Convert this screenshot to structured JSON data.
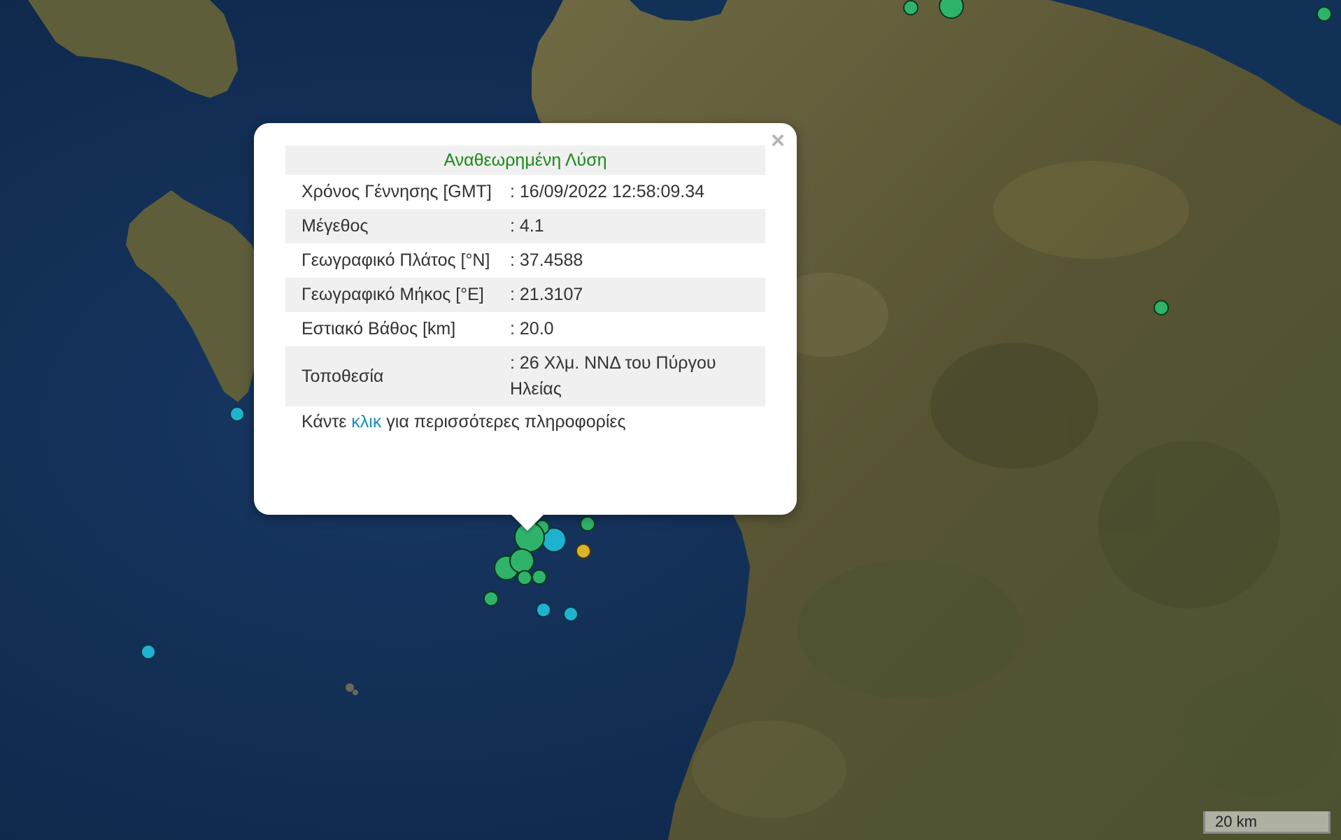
{
  "popup": {
    "title": "Αναθεωρημένη Λύση",
    "close_symbol": "×",
    "rows": [
      {
        "label": "Χρόνος Γέννησης [GMT]",
        "value": ": 16/09/2022 12:58:09.34"
      },
      {
        "label": "Μέγεθος",
        "value": ": 4.1"
      },
      {
        "label": "Γεωγραφικό Πλάτος [°N]",
        "value": ": 37.4588"
      },
      {
        "label": "Γεωγραφικό Μήκος [°E]",
        "value": ": 21.3107"
      },
      {
        "label": "Εστιακό Βάθος [km]",
        "value": ": 20.0"
      },
      {
        "label": "Τοποθεσία",
        "value": ": 26 Χλμ. ΝΝΔ του Πύργου Ηλείας"
      }
    ],
    "footer_prefix": "Κάντε ",
    "footer_link": "κλικ",
    "footer_suffix": " για περισσότερες πληροφορίες"
  },
  "scale_bar": {
    "label": "20 km"
  },
  "colors": {
    "sea": "#0f2a4d",
    "land": "#5c5a36",
    "marker_green": "#2fb36a",
    "marker_cyan": "#1fb2cf",
    "marker_yellow": "#d9b52a",
    "popup_title": "#1a8a1a",
    "link": "#1a8fb8"
  }
}
